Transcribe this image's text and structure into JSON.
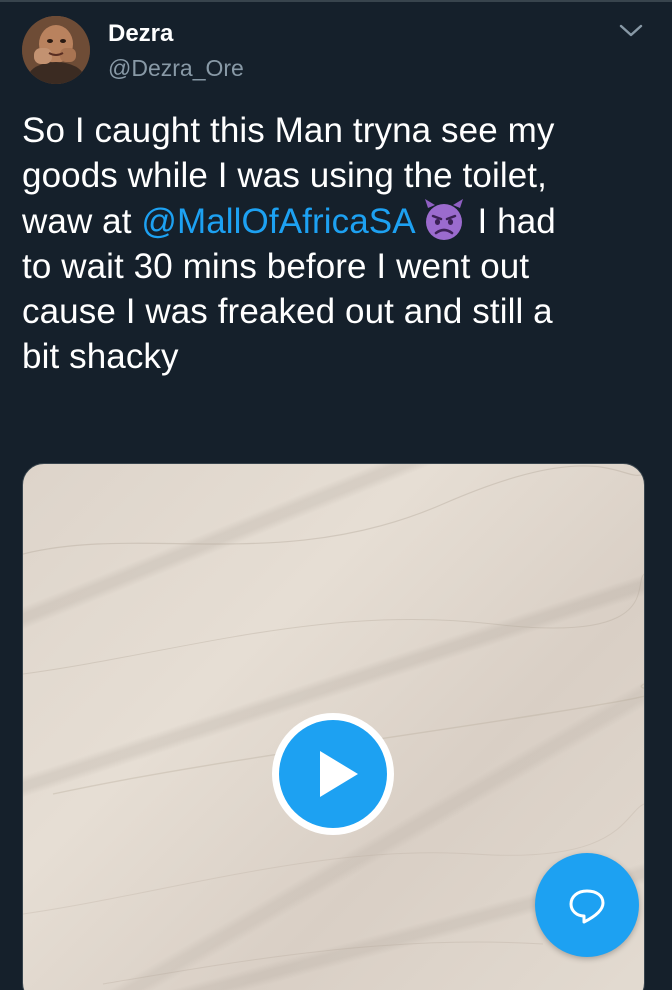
{
  "tweet": {
    "author_name": "Dezra",
    "author_handle": "@Dezra_Ore",
    "text_lines": {
      "l1": "So I caught this Man tryna see my",
      "l2": "goods while I was using the toilet,",
      "l3_before": "waw at ",
      "l3_mention": "@MallOfAfricaSA",
      "l3_after": " I had",
      "l4": "to wait 30 mins before I went out",
      "l5": "cause I was freaked out and still a",
      "l6": "bit shacky"
    },
    "emoji": "angry-devil-emoji"
  },
  "icons": {
    "chevron": "chevron-down-icon",
    "play": "play-icon",
    "compose": "chat-bubble-icon"
  },
  "colors": {
    "background": "#15202b",
    "text": "#ffffff",
    "secondary_text": "#8899a6",
    "accent": "#1da1f2",
    "emoji_purple": "#9b6bce"
  }
}
